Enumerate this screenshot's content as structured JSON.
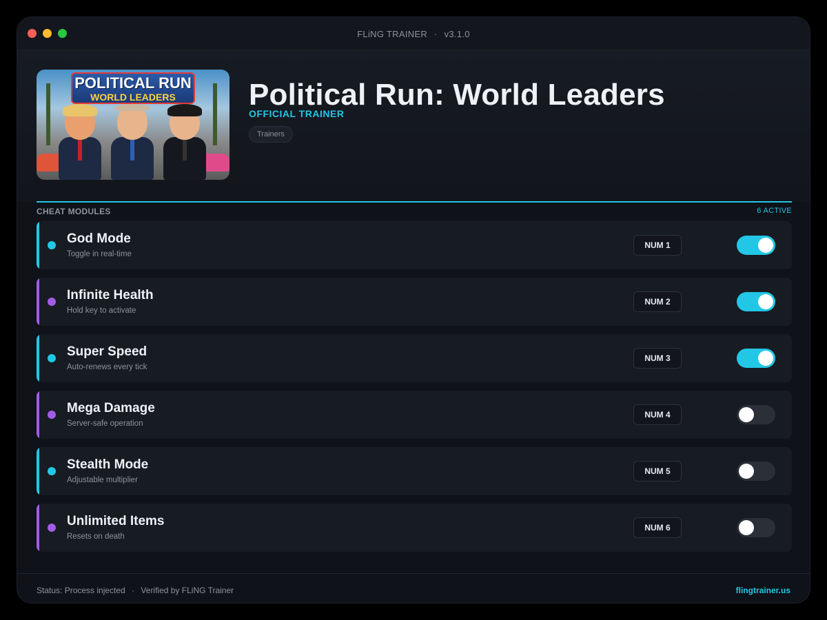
{
  "window": {
    "app_name": "FLiNG TRAINER",
    "separator": "·",
    "version": "v3.1.0"
  },
  "hero": {
    "cover_logo_line1": "POLITICAL RUN",
    "cover_logo_line2": "WORLD LEADERS",
    "game_title": "Political Run: World Leaders",
    "subtitle": "OFFICIAL TRAINER",
    "tag": "Trainers"
  },
  "modules": {
    "label": "CHEAT MODULES",
    "active_count": "6 ACTIVE",
    "items": [
      {
        "name": "God Mode",
        "desc": "Toggle in real-time",
        "key": "NUM 1",
        "enabled": true,
        "accent": "cyan"
      },
      {
        "name": "Infinite Health",
        "desc": "Hold key to activate",
        "key": "NUM 2",
        "enabled": true,
        "accent": "purple"
      },
      {
        "name": "Super Speed",
        "desc": "Auto-renews every tick",
        "key": "NUM 3",
        "enabled": true,
        "accent": "cyan"
      },
      {
        "name": "Mega Damage",
        "desc": "Server-safe operation",
        "key": "NUM 4",
        "enabled": false,
        "accent": "purple"
      },
      {
        "name": "Stealth Mode",
        "desc": "Adjustable multiplier",
        "key": "NUM 5",
        "enabled": false,
        "accent": "cyan"
      },
      {
        "name": "Unlimited Items",
        "desc": "Resets on death",
        "key": "NUM 6",
        "enabled": false,
        "accent": "purple"
      }
    ]
  },
  "footer": {
    "status": "Status: Process injected",
    "separator": "·",
    "verified": "Verified by FLiNG Trainer",
    "site": "flingtrainer.us"
  },
  "colors": {
    "accent_cyan": "#22c7e6",
    "accent_purple": "#a35ce8",
    "background": "#0f1218",
    "card": "#171b22"
  },
  "icons": [
    "close-window-icon",
    "minimize-window-icon",
    "zoom-window-icon",
    "status-indicator-icon",
    "toggle-switch-icon"
  ]
}
